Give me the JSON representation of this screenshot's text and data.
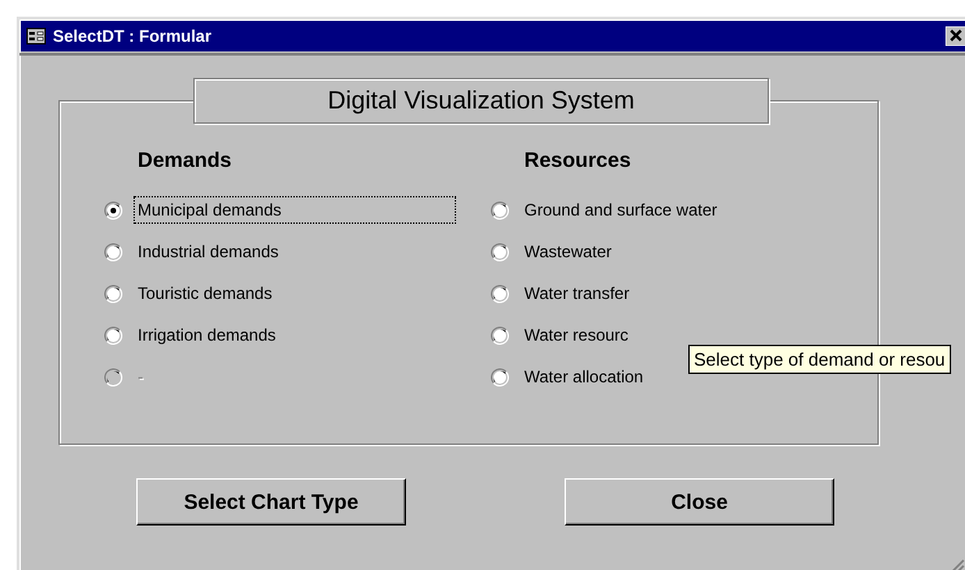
{
  "window": {
    "title": "SelectDT : Formular"
  },
  "heading": "Digital Visualization System",
  "groups": [
    {
      "title": "Demands",
      "options": [
        {
          "label": "Municipal demands",
          "selected": true,
          "disabled": false,
          "focused": true
        },
        {
          "label": "Industrial demands",
          "selected": false,
          "disabled": false,
          "focused": false
        },
        {
          "label": "Touristic demands",
          "selected": false,
          "disabled": false,
          "focused": false
        },
        {
          "label": "Irrigation demands",
          "selected": false,
          "disabled": false,
          "focused": false
        },
        {
          "label": "-",
          "selected": false,
          "disabled": true,
          "focused": false
        }
      ]
    },
    {
      "title": "Resources",
      "options": [
        {
          "label": "Ground and surface water",
          "selected": false,
          "disabled": false,
          "focused": false
        },
        {
          "label": "Wastewater",
          "selected": false,
          "disabled": false,
          "focused": false
        },
        {
          "label": "Water transfer",
          "selected": false,
          "disabled": false,
          "focused": false
        },
        {
          "label": "Water resourc",
          "selected": false,
          "disabled": false,
          "focused": false
        },
        {
          "label": "Water allocation",
          "selected": false,
          "disabled": false,
          "focused": false
        }
      ]
    }
  ],
  "tooltip": "Select type of demand or resou",
  "buttons": [
    "Select Chart Type",
    "Close"
  ]
}
